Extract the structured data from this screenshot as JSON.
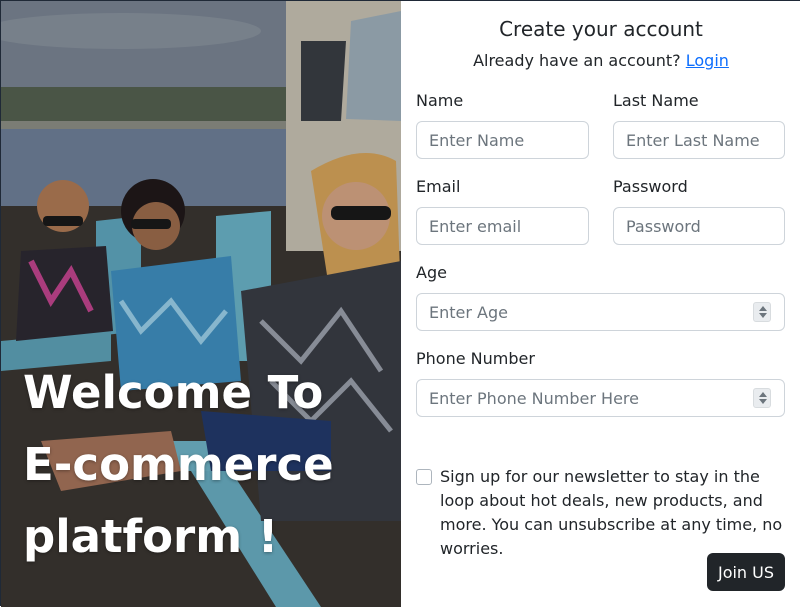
{
  "hero": {
    "title_lines": [
      "Welcome To",
      "E-commerce",
      "platform !"
    ]
  },
  "form": {
    "title": "Create your account",
    "login_prompt": "Already have an account?",
    "login_link": "Login",
    "name": {
      "label": "Name",
      "placeholder": "Enter Name"
    },
    "last_name": {
      "label": "Last Name",
      "placeholder": "Enter Last Name"
    },
    "email": {
      "label": "Email",
      "placeholder": "Enter email"
    },
    "password": {
      "label": "Password",
      "placeholder": "Password"
    },
    "age": {
      "label": "Age",
      "placeholder": "Enter Age"
    },
    "phone": {
      "label": "Phone Number",
      "placeholder": "Enter Phone Number Here"
    },
    "newsletter_text": "Sign up for our newsletter to stay in the loop about hot deals, new products, and more. You can unsubscribe at any time, no worries.",
    "submit_label": "Join US"
  },
  "colors": {
    "link": "#0d6efd",
    "button_bg": "#212529",
    "text": "#212529",
    "placeholder": "#6c757d",
    "border": "#ced4da"
  }
}
